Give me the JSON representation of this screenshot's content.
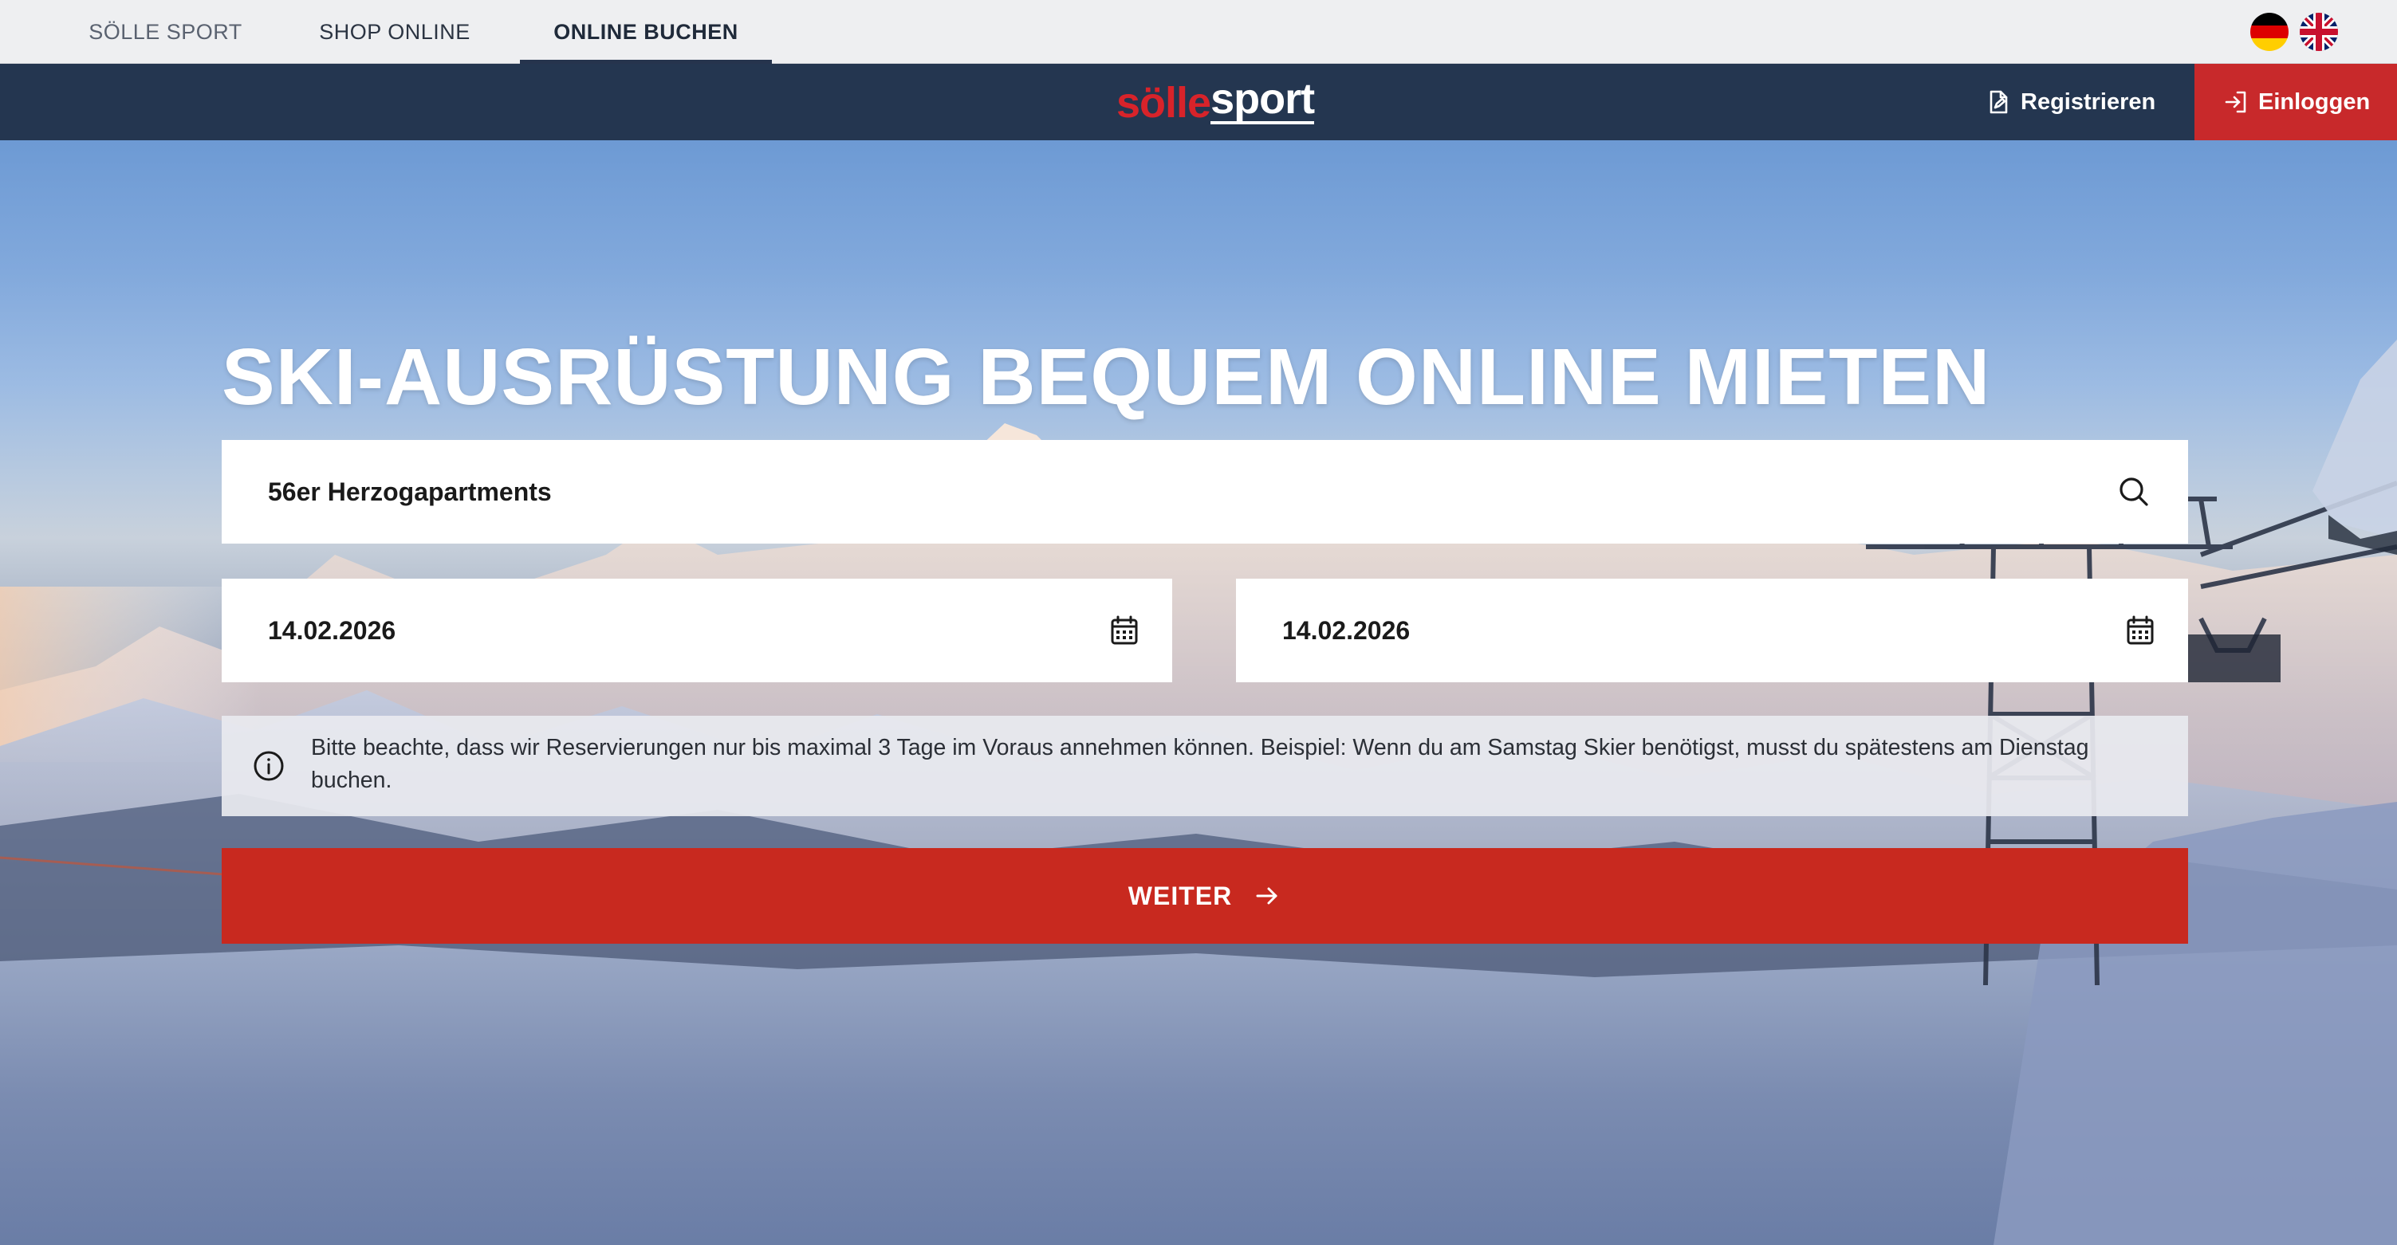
{
  "tabs": [
    {
      "label": "SÖLLE SPORT"
    },
    {
      "label": "SHOP ONLINE"
    },
    {
      "label": "ONLINE BUCHEN",
      "active": true
    }
  ],
  "languages": [
    {
      "code": "de",
      "icon": "german-flag-icon"
    },
    {
      "code": "en",
      "icon": "uk-flag-icon"
    }
  ],
  "header": {
    "logo_part1": "sölle",
    "logo_part2": "sport",
    "register_label": "Registrieren",
    "login_label": "Einloggen"
  },
  "hero": {
    "title": "SKI-AUSRÜSTUNG BEQUEM ONLINE MIETEN"
  },
  "form": {
    "location_value": "56er Herzogapartments",
    "date_from": "14.02.2026",
    "date_to": "14.02.2026",
    "notice": "Bitte beachte, dass wir Reservierungen nur bis maximal 3 Tage im Voraus annehmen können. Beispiel: Wenn du am Samstag Skier benötigst, musst du spätestens am Dienstag buchen.",
    "submit_label": "WEITER"
  },
  "colors": {
    "navbar": "#243650",
    "accent_red": "#c8292b",
    "tabbar": "#eeeff1"
  }
}
